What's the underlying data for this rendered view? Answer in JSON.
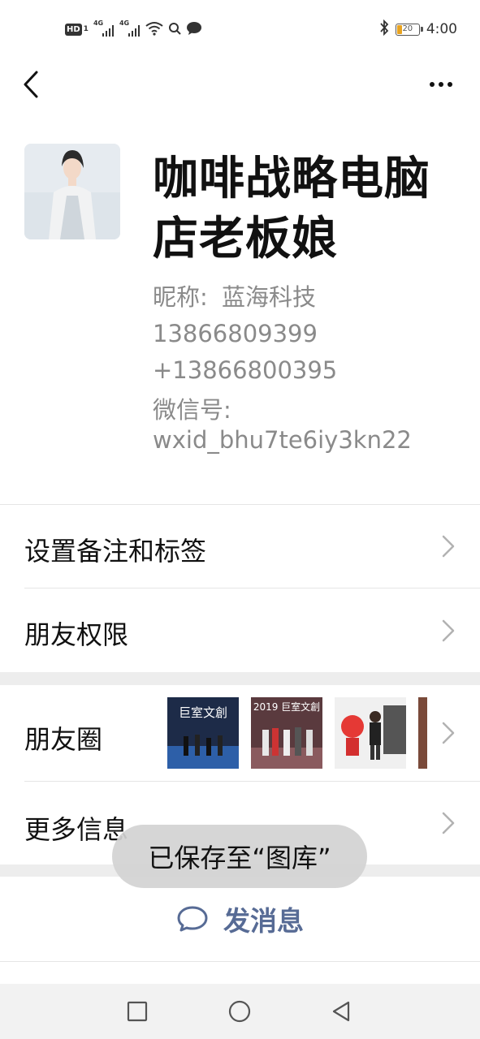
{
  "status_bar": {
    "hd_label": "HD",
    "hd_sub": "1",
    "signal_1_tag": "4G",
    "signal_2_tag": "4G",
    "time": "4:00",
    "battery_level": "20",
    "icons": [
      "signal-icon",
      "signal-icon",
      "wifi-icon",
      "search-icon",
      "chat-bubble-icon",
      "bluetooth-icon",
      "battery-icon"
    ]
  },
  "header": {
    "back_icon": "chevron-left-icon",
    "more_icon": "more-dots-icon"
  },
  "profile": {
    "name": "咖啡战略电脑店老板娘",
    "nickname_label": "昵称:",
    "nickname": "蓝海科技",
    "phone_1": "13866809399",
    "phone_2": "+13866800395",
    "wechat_id_label": "微信号:",
    "wechat_id": "wxid_bhu7te6iy3kn22"
  },
  "menu": {
    "remark_label": "设置备注和标签",
    "permission_label": "朋友权限",
    "moments_label": "朋友圈",
    "more_info_label": "更多信息"
  },
  "moments_thumbs": {
    "thumb1_text": "巨室文創",
    "thumb2_text": "2019 巨室文創"
  },
  "actions": {
    "send_message_label": "发消息",
    "send_icon": "chat-bubble-icon"
  },
  "toast": {
    "text": "已保存至“图库”"
  },
  "nav": {
    "icons": [
      "square-icon",
      "circle-home-icon",
      "triangle-back-icon"
    ]
  },
  "colors": {
    "link_blue": "#576b95",
    "secondary_text": "#8a8a8a",
    "band_gray": "#ededed",
    "battery_orange": "#e8a320"
  }
}
